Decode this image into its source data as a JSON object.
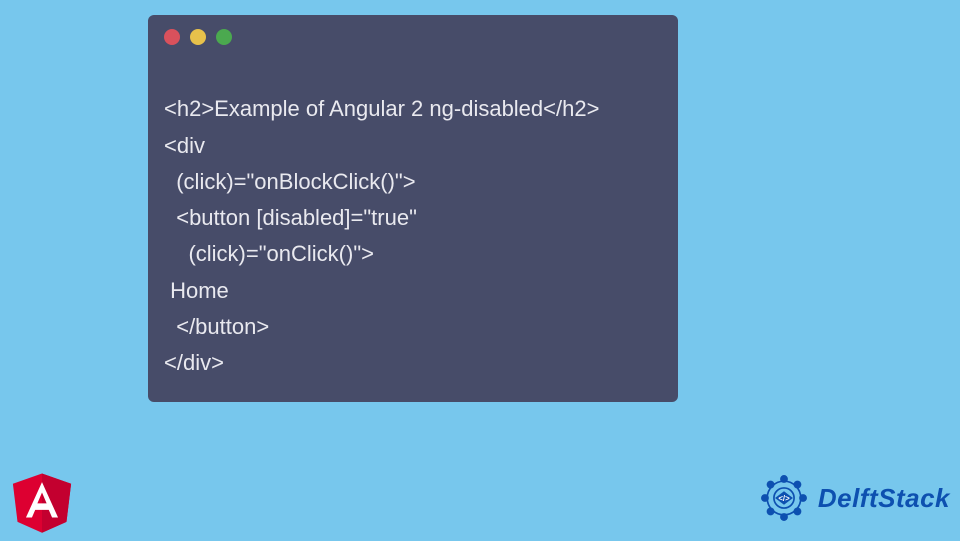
{
  "code": {
    "lines": [
      "<h2>Example of Angular 2 ng-disabled</h2>",
      "<div",
      "  (click)=\"onBlockClick()\">",
      "  <button [disabled]=\"true\"",
      "    (click)=\"onClick()\">",
      " Home",
      "  </button>",
      "</div>"
    ]
  },
  "brand": {
    "name": "DelftStack"
  }
}
